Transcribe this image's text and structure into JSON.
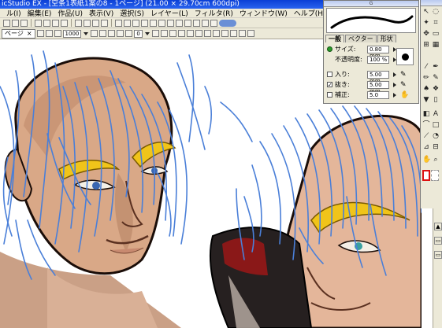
{
  "window": {
    "title": "icStudio EX - [空条1表紙1案の8 - 1ページ] (21.00 × 29.70cm 600dpi)"
  },
  "menu": [
    "ル(I)",
    "編集(E)",
    "作品(U)",
    "表示(V)",
    "選択(S)",
    "レイヤー(L)",
    "フィルタ(R)",
    "ウィンドウ(W)",
    "ヘルプ(H)"
  ],
  "toolbar2": {
    "doc_tab_label": "ページ",
    "doc_tab_close": "×",
    "zoom_value": "1000",
    "rotation_value": "0"
  },
  "brush_palette": {
    "header": "G",
    "tabs": [
      "一般",
      "ベクター",
      "形状"
    ],
    "rows": [
      {
        "label": "サイズ:",
        "value": "0.80 mm"
      },
      {
        "label": "不透明度:",
        "value": "100 %"
      },
      {
        "label": "入り:",
        "value": "5.00 mm",
        "checked": false
      },
      {
        "label": "抜き:",
        "value": "5.00 mm",
        "checked": true
      },
      {
        "label": "補正:",
        "value": "5.0",
        "checked": false
      }
    ]
  },
  "tools": {
    "text_tool_glyph": "A"
  },
  "icons": [
    "search-icon",
    "hand-icon",
    "pen-icon",
    "eraser-icon",
    "bucket-icon",
    "text-icon",
    "eyedropper-icon",
    "lasso-icon",
    "close-icon",
    "chevron-down-icon"
  ],
  "colors": {
    "title_bar": "#0b3fd6",
    "chrome": "#ece9d8",
    "vector_line": "#4a7fd8",
    "eyebrow": "#f0c41a",
    "skin": "#d9a887",
    "main_color_border": "#dd1111"
  }
}
